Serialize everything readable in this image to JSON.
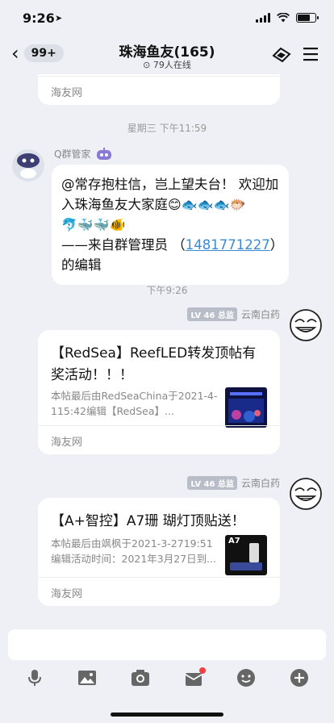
{
  "status_bar": {
    "time": "9:26"
  },
  "nav": {
    "back_count": "99+",
    "title": "珠海鱼友(165)",
    "online": "79人在线"
  },
  "messages": {
    "top_card_footer": "海友网",
    "time1": "星期三 下午11:59",
    "bot": {
      "name": "Q群管家",
      "line1": "@常存抱柱信，岂上望夫台！ 欢迎加入珠海鱼友大家庭",
      "emoji1": "😊🐟🐟🐟🐡",
      "emoji2": "🐬🐳🐳🐠",
      "line3_prefix": "——来自群管理员 （",
      "line3_link": "1481771227",
      "line3_suffix": "）的编辑"
    },
    "time2": "下午9:26",
    "card1": {
      "sender_level": "LV 46",
      "sender_title": "总监",
      "sender_name": "云南白药",
      "title": "【RedSea】ReefLED转发顶帖有奖活动！！！",
      "desc": "本帖最后由RedSeaChina于2021-4-115:42编辑【RedSea】...",
      "footer": "海友网"
    },
    "card2": {
      "sender_level": "LV 46",
      "sender_title": "总监",
      "sender_name": "云南白药",
      "title": "【A+智控】A7珊 瑚灯顶贴送！",
      "desc": "本帖最后由飒枫于2021-3-2719:51 编辑活动时间：2021年3月27日到...",
      "thumb_label": "A7",
      "footer": "海友网"
    }
  },
  "toolbar": {
    "icons": [
      "microphone-icon",
      "image-icon",
      "camera-icon",
      "red-packet-icon",
      "emoji-icon",
      "plus-icon"
    ]
  },
  "colors": {
    "background": "#eef0f5",
    "link": "#3a8bd6",
    "badge": "#b9bdc8",
    "notification": "#f04040"
  }
}
